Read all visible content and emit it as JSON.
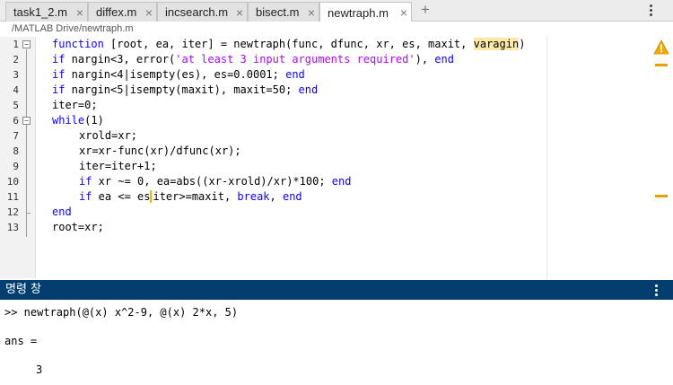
{
  "tabs": [
    {
      "label": "task1_2.m",
      "active": false
    },
    {
      "label": "diffex.m",
      "active": false
    },
    {
      "label": "incsearch.m",
      "active": false
    },
    {
      "label": "bisect.m",
      "active": false
    },
    {
      "label": "newtraph.m",
      "active": true
    }
  ],
  "add_tab_symbol": "+",
  "close_symbol": "×",
  "path": "/MATLAB Drive/newtraph.m",
  "line_numbers": [
    "1",
    "2",
    "3",
    "4",
    "5",
    "6",
    "7",
    "8",
    "9",
    "10",
    "11",
    "12",
    "13"
  ],
  "code": {
    "l1_kw": "function",
    "l1_a": " [root, ea, iter] = newtraph(func, dfunc, xr, es, maxit, ",
    "l1_warn": "varagin",
    "l1_b": ")",
    "l2_kw": "if",
    "l2_a": " nargin<3, error(",
    "l2_str": "'at least 3 input arguments required'",
    "l2_b": "), ",
    "l2_end": "end",
    "l3_kw": "if",
    "l3_a": " nargin<4|isempty(es), es=0.0001; ",
    "l3_end": "end",
    "l4_kw": "if",
    "l4_a": " nargin<5|isempty(maxit), maxit=50; ",
    "l4_end": "end",
    "l5": "iter=0;",
    "l6_kw": "while",
    "l6_a": "(1)",
    "l7": "xrold=xr;",
    "l8": "xr=xr-func(xr)/dfunc(xr);",
    "l9": "iter=iter+1;",
    "l10_kw": "if",
    "l10_a": " xr ~= 0, ea=abs((xr-xrold)/xr)*100; ",
    "l10_end": "end",
    "l11_kw": "if",
    "l11_a": " ea <= es",
    "l11_b": "iter>=maxit, ",
    "l11_break": "break",
    "l11_c": ", ",
    "l11_end": "end",
    "l12": "end",
    "l13": "root=xr;"
  },
  "command_window": {
    "title": "명령 창",
    "lines": [
      ">> newtraph(@(x) x^2-9, @(x) 2*x, 5)",
      "ans =",
      "3"
    ]
  },
  "colors": {
    "keyword": "#0e00ff",
    "string": "#a709f5",
    "warning": "#e8a000",
    "command_header": "#033e6e"
  },
  "icons": {
    "warning": "warning-triangle-icon",
    "kebab": "more-options-icon"
  }
}
